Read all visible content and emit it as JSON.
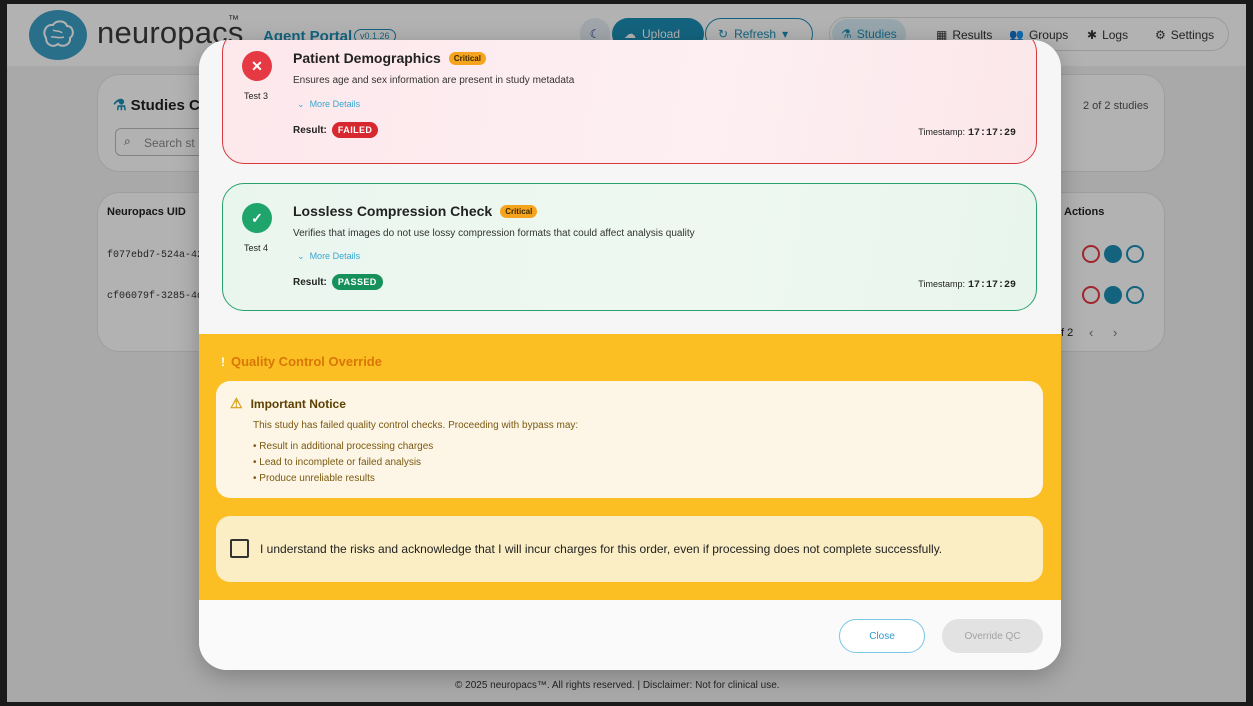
{
  "app": {
    "logo": "neuropacs",
    "logo_tm": "™",
    "portal_title": "Agent Portal",
    "version": "v0.1.26",
    "upload_label": "Upload",
    "refresh_label": "Refresh",
    "nav": [
      {
        "label": "Studies"
      },
      {
        "label": "Results"
      },
      {
        "label": "Groups"
      },
      {
        "label": "Logs"
      },
      {
        "label": "Settings"
      }
    ],
    "studies_heading": "Studies C",
    "search_placeholder": "Search st",
    "studies_count": "2 of 2 studies",
    "table_header_uid": "Neuropacs UID",
    "table_header_actions": "Actions",
    "rows": [
      "f077ebd7-524a-42",
      "cf06079f-3285-4dd"
    ],
    "pagination": "f 2",
    "footer_text": "© 2025 neuropacs™. All rights reserved. | Disclaimer: Not for clinical use."
  },
  "modal": {
    "tests": [
      {
        "num": "Test 3",
        "title": "Patient Demographics",
        "badge": "Critical",
        "description": "Ensures age and sex information are present in study metadata",
        "more": "More Details",
        "result_label": "Result:",
        "result": "FAILED",
        "timestamp_label": "Timestamp:",
        "timestamp": "17:17:29"
      },
      {
        "num": "Test 4",
        "title": "Lossless Compression Check",
        "badge": "Critical",
        "description": "Verifies that images do not use lossy compression formats that could affect analysis quality",
        "more": "More Details",
        "result_label": "Result:",
        "result": "PASSED",
        "timestamp_label": "Timestamp:",
        "timestamp": "17:17:29"
      }
    ],
    "qc": {
      "title": "Quality Control Override",
      "notice_title": "Important Notice",
      "notice_desc": "This study has failed quality control checks. Proceeding with bypass may:",
      "notice_items": [
        "• Result in additional processing charges",
        "• Lead to incomplete or failed analysis",
        "• Produce unreliable results"
      ],
      "ack_text": "I understand the risks and acknowledge that I will incur charges for this order, even if processing does not complete successfully."
    },
    "footer": {
      "close": "Close",
      "override": "Override QC"
    }
  },
  "colors": {
    "accent": "#1e8fb5",
    "fail": "#e53943",
    "pass": "#1fa56c",
    "warning": "#fbbf24",
    "badge": "#f6a41d"
  }
}
